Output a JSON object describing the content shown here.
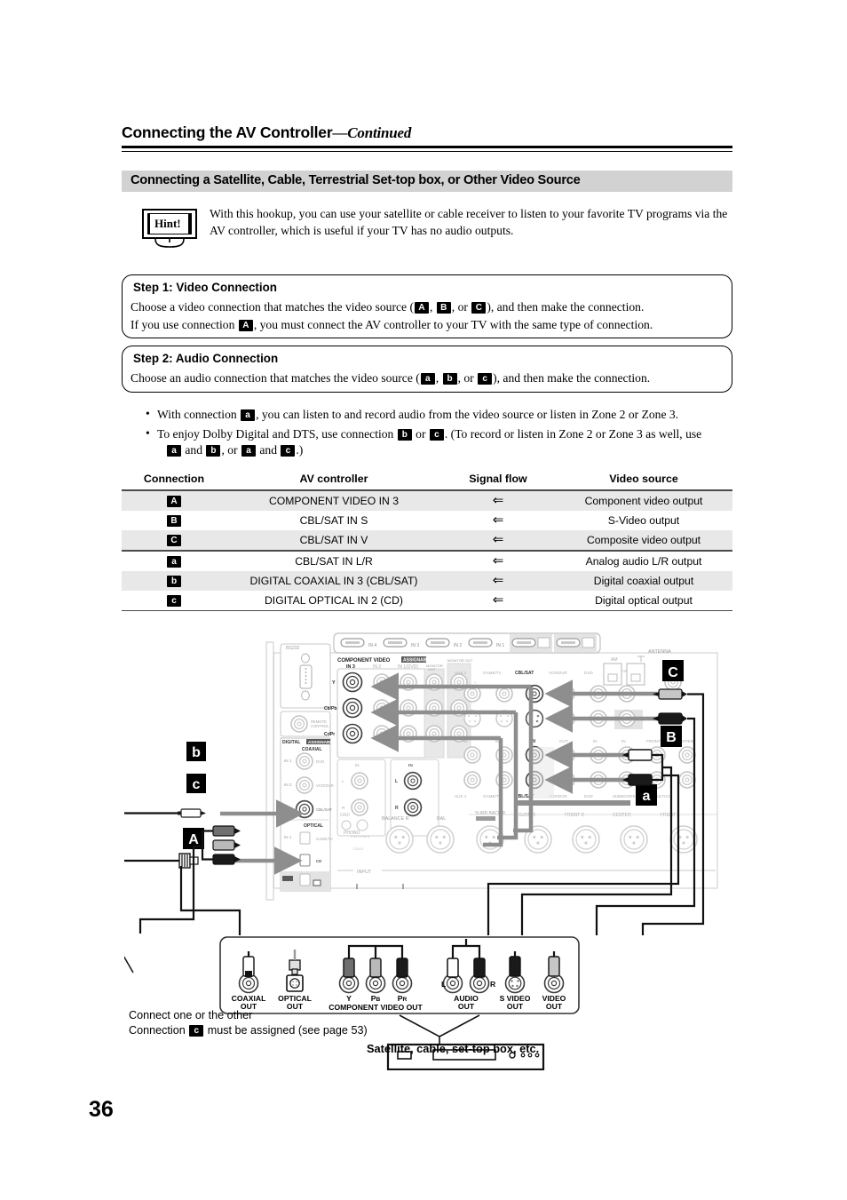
{
  "header": {
    "title": "Connecting the AV Controller",
    "continued": "—Continued"
  },
  "section": {
    "band_title": "Connecting a Satellite, Cable, Terrestrial Set-top box, or Other Video Source"
  },
  "hint": {
    "label": "Hint!",
    "text": "With this hookup, you can use your satellite or cable receiver to listen to your favorite TV programs via the AV controller, which is useful if your TV has no audio outputs."
  },
  "step1": {
    "title": "Step 1: Video Connection",
    "line1_a": "Choose a video connection that matches the video source (",
    "line1_b": ", ",
    "line1_c": ", or ",
    "line1_d": "), and then make the connection.",
    "badge_a": "A",
    "badge_b": "B",
    "badge_c": "C",
    "line2_a": "If you use connection ",
    "line2_badge": "A",
    "line2_b": ", you must connect the AV controller to your TV with the same type of connection."
  },
  "step2": {
    "title": "Step 2: Audio Connection",
    "line1_a": "Choose an audio connection that matches the video source (",
    "line1_b": ", ",
    "line1_c": ", or ",
    "line1_d": "), and then make the connection.",
    "badge_a": "a",
    "badge_b": "b",
    "badge_c": "c"
  },
  "bullets": [
    {
      "pre": "With connection ",
      "badge": "a",
      "post": ", you can listen to and record audio from the video source or listen in Zone 2 or Zone 3."
    },
    {
      "pre": "To enjoy Dolby Digital and DTS, use connection ",
      "badge1": "b",
      "mid1": " or ",
      "badge2": "c",
      "mid2": ". (To record or listen in Zone 2 or Zone 3 as well, use",
      "l2_b1": "a",
      "l2_m1": " and ",
      "l2_b2": "b",
      "l2_m2": ", or ",
      "l2_b3": "a",
      "l2_m3": " and ",
      "l2_b4": "c",
      "l2_m4": ".)"
    }
  ],
  "table": {
    "headers": [
      "Connection",
      "AV controller",
      "Signal flow",
      "Video source"
    ],
    "flow_glyph": "⇐",
    "rows": [
      {
        "connection": "A",
        "av_controller": "COMPONENT VIDEO IN 3",
        "video_source": "Component video output"
      },
      {
        "connection": "B",
        "av_controller": "CBL/SAT IN S",
        "video_source": "S-Video output"
      },
      {
        "connection": "C",
        "av_controller": "CBL/SAT IN V",
        "video_source": "Composite video output"
      },
      {
        "connection": "a",
        "av_controller": "CBL/SAT IN L/R",
        "video_source": "Analog audio L/R output"
      },
      {
        "connection": "b",
        "av_controller": "DIGITAL COAXIAL IN 3 (CBL/SAT)",
        "video_source": "Digital coaxial output"
      },
      {
        "connection": "c",
        "av_controller": "DIGITAL OPTICAL IN 2 (CD)",
        "video_source": "Digital optical output"
      }
    ]
  },
  "diagram": {
    "callouts": {
      "b": "b",
      "c": "c",
      "A": "A",
      "C": "C",
      "B": "B",
      "a": "a"
    },
    "rear_panel_labels": {
      "rs232": "RS232",
      "component_video": "COMPONENT VIDEO",
      "component_assignable": "ASSIGNABLE",
      "in3": "IN 3",
      "in2": "IN 2",
      "in1": "IN 1(DVD)",
      "y": "Y",
      "cb": "Cb/Pb",
      "cr": "Cr/Pr",
      "digital": "DIGITAL",
      "coaxial": "COAXIAL",
      "optical": "OPTICAL",
      "din1": "IN 1",
      "din2": "IN 2",
      "din3": "IN 3",
      "phono": "PHONO",
      "cd": "CD",
      "aux1": "AUX 1",
      "gametv": "GAME/TV",
      "cblsat": "CBL/SAT",
      "vcrdvr": "VCR/DVR",
      "dvd": "DVD",
      "antenna": "ANTENNA",
      "am": "AM",
      "ir": "IR",
      "front_l": "FRONT L",
      "center": "CENTER",
      "front_r": "FRONT R",
      "surr_r": "SURR R",
      "surr_back_r": "SURR BACK R",
      "balance_r": "BALANCE R",
      "input": "INPUT",
      "multich": "MULTICH",
      "in": "IN",
      "hdmi_in4": "IN 4",
      "hdmi_in3": "IN 3",
      "hdmi_in2": "IN 2",
      "hdmi_in1": "IN 1"
    },
    "source_panel": {
      "jacks": [
        {
          "label1": "COAXIAL",
          "label2": "OUT"
        },
        {
          "label1": "OPTICAL",
          "label2": "OUT"
        },
        {
          "label1": "Y",
          "label2": ""
        },
        {
          "label1": "PB",
          "label2": ""
        },
        {
          "label1": "PR",
          "label2": ""
        },
        {
          "label1": "AUDIO",
          "label2": "OUT"
        },
        {
          "label1": "S VIDEO",
          "label2": "OUT"
        },
        {
          "label1": "VIDEO",
          "label2": "OUT"
        }
      ],
      "component_caption": "COMPONENT VIDEO OUT",
      "left_mark": "L",
      "right_mark": "R"
    },
    "device_caption": "Satellite, cable, set-top box, etc."
  },
  "notes": {
    "note1": "Connect one or the other",
    "note2_pre": "Connection ",
    "note2_badge": "c",
    "note2_post": " must be assigned (see page 53)"
  },
  "page_number": "36"
}
